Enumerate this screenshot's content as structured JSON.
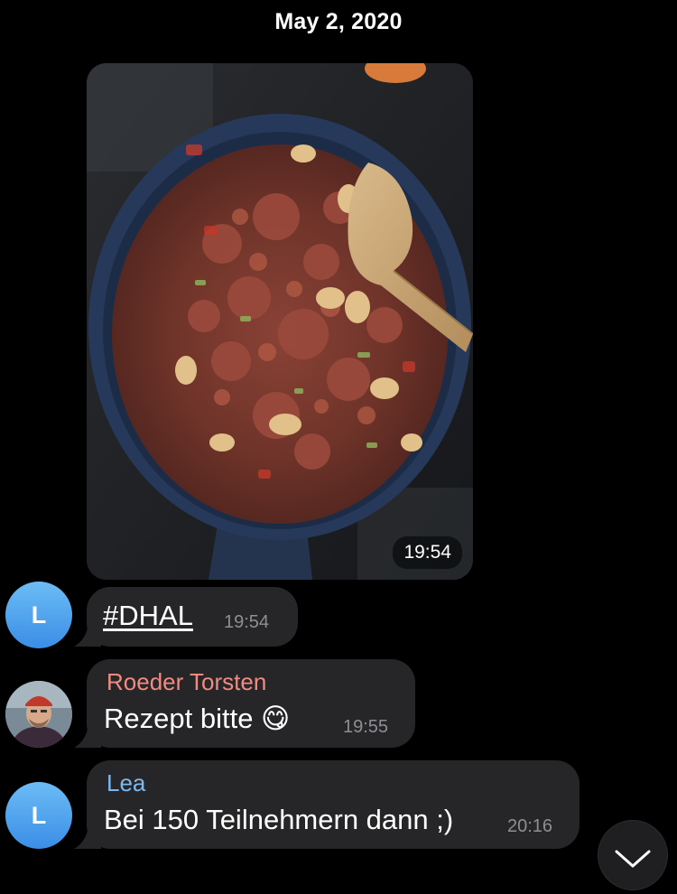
{
  "chat": {
    "date_header": "May 2, 2020",
    "messages": [
      {
        "type": "photo",
        "time": "19:54",
        "image_icon": "photo-of-cooking-pan"
      },
      {
        "type": "text",
        "avatar_letter": "L",
        "text": "#DHAL",
        "time": "19:54"
      },
      {
        "type": "text",
        "sender": "Roeder Torsten",
        "sender_color": "#f08b80",
        "text": "Rezept bitte 😋",
        "time": "19:55",
        "avatar_icon": "profile-photo"
      },
      {
        "type": "text",
        "avatar_letter": "L",
        "sender": "Lea",
        "sender_color": "#7db9ef",
        "text": "Bei 150 Teilnehmern dann ;)",
        "time": "20:16"
      }
    ],
    "scroll_button_icon": "chevron-down-icon"
  },
  "colors": {
    "background": "#000000",
    "bubble": "#262628",
    "avatar_gradient_top": "#6cbcf5",
    "avatar_gradient_bottom": "#3a8ee6"
  }
}
